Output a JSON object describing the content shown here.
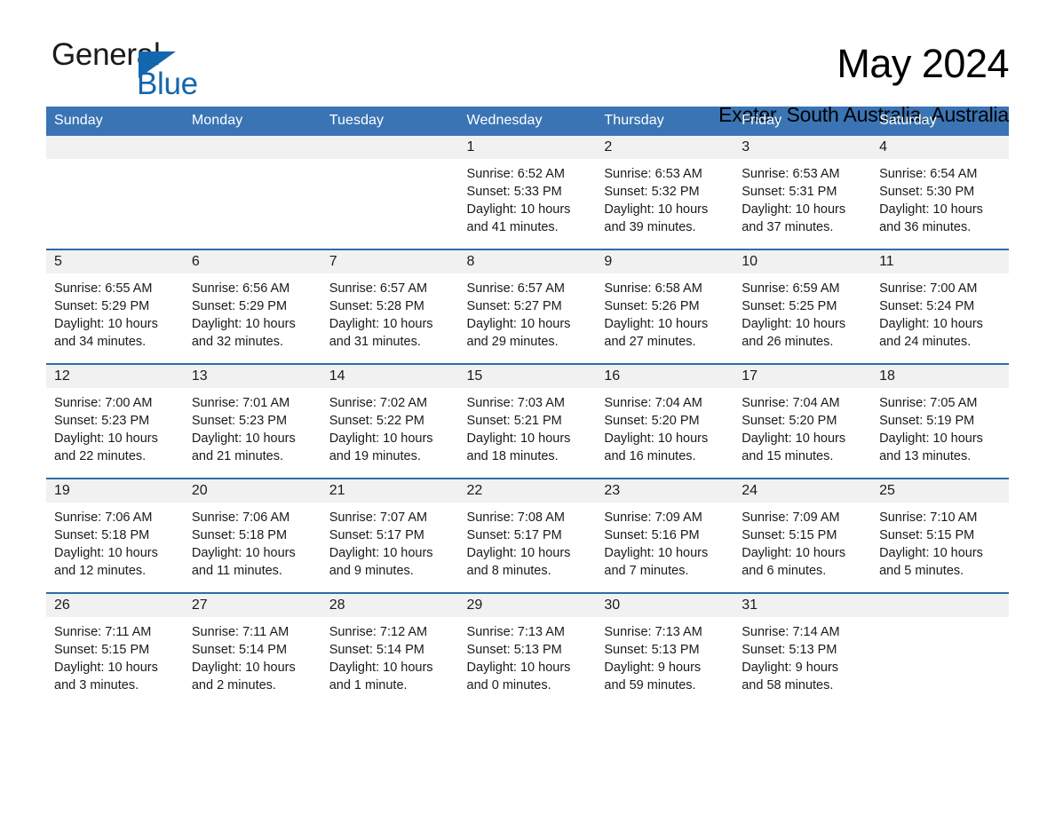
{
  "brand": {
    "name_dark": "General",
    "name_light": "Blue",
    "triangle_color": "#1267b0"
  },
  "header": {
    "title": "May 2024",
    "subtitle": "Exeter, South Australia, Australia"
  },
  "theme": {
    "header_blue": "#3a74b4",
    "separator_blue": "#2e6da4",
    "daynum_band": "#f1f1f1",
    "text": "#1a1a1a"
  },
  "weekday_headers": [
    "Sunday",
    "Monday",
    "Tuesday",
    "Wednesday",
    "Thursday",
    "Friday",
    "Saturday"
  ],
  "weeks": [
    [
      {
        "day": "",
        "sunrise": "",
        "sunset": "",
        "daylight_1": "",
        "daylight_2": ""
      },
      {
        "day": "",
        "sunrise": "",
        "sunset": "",
        "daylight_1": "",
        "daylight_2": ""
      },
      {
        "day": "",
        "sunrise": "",
        "sunset": "",
        "daylight_1": "",
        "daylight_2": ""
      },
      {
        "day": "1",
        "sunrise": "Sunrise: 6:52 AM",
        "sunset": "Sunset: 5:33 PM",
        "daylight_1": "Daylight: 10 hours",
        "daylight_2": "and 41 minutes."
      },
      {
        "day": "2",
        "sunrise": "Sunrise: 6:53 AM",
        "sunset": "Sunset: 5:32 PM",
        "daylight_1": "Daylight: 10 hours",
        "daylight_2": "and 39 minutes."
      },
      {
        "day": "3",
        "sunrise": "Sunrise: 6:53 AM",
        "sunset": "Sunset: 5:31 PM",
        "daylight_1": "Daylight: 10 hours",
        "daylight_2": "and 37 minutes."
      },
      {
        "day": "4",
        "sunrise": "Sunrise: 6:54 AM",
        "sunset": "Sunset: 5:30 PM",
        "daylight_1": "Daylight: 10 hours",
        "daylight_2": "and 36 minutes."
      }
    ],
    [
      {
        "day": "5",
        "sunrise": "Sunrise: 6:55 AM",
        "sunset": "Sunset: 5:29 PM",
        "daylight_1": "Daylight: 10 hours",
        "daylight_2": "and 34 minutes."
      },
      {
        "day": "6",
        "sunrise": "Sunrise: 6:56 AM",
        "sunset": "Sunset: 5:29 PM",
        "daylight_1": "Daylight: 10 hours",
        "daylight_2": "and 32 minutes."
      },
      {
        "day": "7",
        "sunrise": "Sunrise: 6:57 AM",
        "sunset": "Sunset: 5:28 PM",
        "daylight_1": "Daylight: 10 hours",
        "daylight_2": "and 31 minutes."
      },
      {
        "day": "8",
        "sunrise": "Sunrise: 6:57 AM",
        "sunset": "Sunset: 5:27 PM",
        "daylight_1": "Daylight: 10 hours",
        "daylight_2": "and 29 minutes."
      },
      {
        "day": "9",
        "sunrise": "Sunrise: 6:58 AM",
        "sunset": "Sunset: 5:26 PM",
        "daylight_1": "Daylight: 10 hours",
        "daylight_2": "and 27 minutes."
      },
      {
        "day": "10",
        "sunrise": "Sunrise: 6:59 AM",
        "sunset": "Sunset: 5:25 PM",
        "daylight_1": "Daylight: 10 hours",
        "daylight_2": "and 26 minutes."
      },
      {
        "day": "11",
        "sunrise": "Sunrise: 7:00 AM",
        "sunset": "Sunset: 5:24 PM",
        "daylight_1": "Daylight: 10 hours",
        "daylight_2": "and 24 minutes."
      }
    ],
    [
      {
        "day": "12",
        "sunrise": "Sunrise: 7:00 AM",
        "sunset": "Sunset: 5:23 PM",
        "daylight_1": "Daylight: 10 hours",
        "daylight_2": "and 22 minutes."
      },
      {
        "day": "13",
        "sunrise": "Sunrise: 7:01 AM",
        "sunset": "Sunset: 5:23 PM",
        "daylight_1": "Daylight: 10 hours",
        "daylight_2": "and 21 minutes."
      },
      {
        "day": "14",
        "sunrise": "Sunrise: 7:02 AM",
        "sunset": "Sunset: 5:22 PM",
        "daylight_1": "Daylight: 10 hours",
        "daylight_2": "and 19 minutes."
      },
      {
        "day": "15",
        "sunrise": "Sunrise: 7:03 AM",
        "sunset": "Sunset: 5:21 PM",
        "daylight_1": "Daylight: 10 hours",
        "daylight_2": "and 18 minutes."
      },
      {
        "day": "16",
        "sunrise": "Sunrise: 7:04 AM",
        "sunset": "Sunset: 5:20 PM",
        "daylight_1": "Daylight: 10 hours",
        "daylight_2": "and 16 minutes."
      },
      {
        "day": "17",
        "sunrise": "Sunrise: 7:04 AM",
        "sunset": "Sunset: 5:20 PM",
        "daylight_1": "Daylight: 10 hours",
        "daylight_2": "and 15 minutes."
      },
      {
        "day": "18",
        "sunrise": "Sunrise: 7:05 AM",
        "sunset": "Sunset: 5:19 PM",
        "daylight_1": "Daylight: 10 hours",
        "daylight_2": "and 13 minutes."
      }
    ],
    [
      {
        "day": "19",
        "sunrise": "Sunrise: 7:06 AM",
        "sunset": "Sunset: 5:18 PM",
        "daylight_1": "Daylight: 10 hours",
        "daylight_2": "and 12 minutes."
      },
      {
        "day": "20",
        "sunrise": "Sunrise: 7:06 AM",
        "sunset": "Sunset: 5:18 PM",
        "daylight_1": "Daylight: 10 hours",
        "daylight_2": "and 11 minutes."
      },
      {
        "day": "21",
        "sunrise": "Sunrise: 7:07 AM",
        "sunset": "Sunset: 5:17 PM",
        "daylight_1": "Daylight: 10 hours",
        "daylight_2": "and 9 minutes."
      },
      {
        "day": "22",
        "sunrise": "Sunrise: 7:08 AM",
        "sunset": "Sunset: 5:17 PM",
        "daylight_1": "Daylight: 10 hours",
        "daylight_2": "and 8 minutes."
      },
      {
        "day": "23",
        "sunrise": "Sunrise: 7:09 AM",
        "sunset": "Sunset: 5:16 PM",
        "daylight_1": "Daylight: 10 hours",
        "daylight_2": "and 7 minutes."
      },
      {
        "day": "24",
        "sunrise": "Sunrise: 7:09 AM",
        "sunset": "Sunset: 5:15 PM",
        "daylight_1": "Daylight: 10 hours",
        "daylight_2": "and 6 minutes."
      },
      {
        "day": "25",
        "sunrise": "Sunrise: 7:10 AM",
        "sunset": "Sunset: 5:15 PM",
        "daylight_1": "Daylight: 10 hours",
        "daylight_2": "and 5 minutes."
      }
    ],
    [
      {
        "day": "26",
        "sunrise": "Sunrise: 7:11 AM",
        "sunset": "Sunset: 5:15 PM",
        "daylight_1": "Daylight: 10 hours",
        "daylight_2": "and 3 minutes."
      },
      {
        "day": "27",
        "sunrise": "Sunrise: 7:11 AM",
        "sunset": "Sunset: 5:14 PM",
        "daylight_1": "Daylight: 10 hours",
        "daylight_2": "and 2 minutes."
      },
      {
        "day": "28",
        "sunrise": "Sunrise: 7:12 AM",
        "sunset": "Sunset: 5:14 PM",
        "daylight_1": "Daylight: 10 hours",
        "daylight_2": "and 1 minute."
      },
      {
        "day": "29",
        "sunrise": "Sunrise: 7:13 AM",
        "sunset": "Sunset: 5:13 PM",
        "daylight_1": "Daylight: 10 hours",
        "daylight_2": "and 0 minutes."
      },
      {
        "day": "30",
        "sunrise": "Sunrise: 7:13 AM",
        "sunset": "Sunset: 5:13 PM",
        "daylight_1": "Daylight: 9 hours",
        "daylight_2": "and 59 minutes."
      },
      {
        "day": "31",
        "sunrise": "Sunrise: 7:14 AM",
        "sunset": "Sunset: 5:13 PM",
        "daylight_1": "Daylight: 9 hours",
        "daylight_2": "and 58 minutes."
      },
      {
        "day": "",
        "sunrise": "",
        "sunset": "",
        "daylight_1": "",
        "daylight_2": ""
      }
    ]
  ]
}
